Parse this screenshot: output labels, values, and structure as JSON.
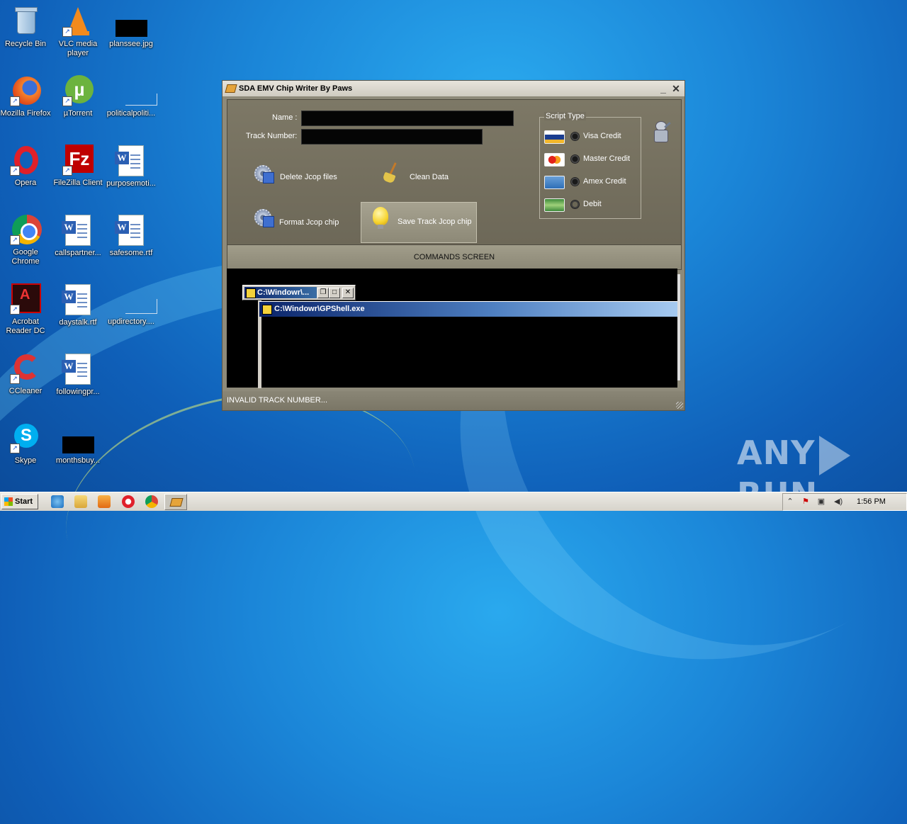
{
  "desktop": {
    "icons": [
      {
        "label": "Recycle Bin"
      },
      {
        "label": "VLC media player"
      },
      {
        "label": "planssee.jpg"
      },
      {
        "label": "Mozilla Firefox"
      },
      {
        "label": "µTorrent"
      },
      {
        "label": "politicalpoliti..."
      },
      {
        "label": "Opera"
      },
      {
        "label": "FileZilla Client"
      },
      {
        "label": "purposemoti..."
      },
      {
        "label": "Google Chrome"
      },
      {
        "label": "callspartner..."
      },
      {
        "label": "safesome.rtf"
      },
      {
        "label": "Acrobat Reader DC"
      },
      {
        "label": "daystalk.rtf"
      },
      {
        "label": "updirectory...."
      },
      {
        "label": "CCleaner"
      },
      {
        "label": "followingpr..."
      },
      {
        "label": "Skype"
      },
      {
        "label": "monthsbuy..."
      }
    ]
  },
  "app": {
    "title": "SDA EMV Chip Writer  By Paws",
    "name_label": "Name :",
    "name_value": "",
    "track_label": "Track Number:",
    "track_value": "",
    "delete_label": "Delete Jcop files",
    "clean_label": "Clean Data",
    "format_label": "Format Jcop chip",
    "save_label": "Save Track Jcop chip",
    "script_type_title": "Script Type",
    "script_types": [
      {
        "label": "Visa Credit",
        "card": "VISA",
        "selected": false
      },
      {
        "label": "Master Credit",
        "card": "MC",
        "selected": false
      },
      {
        "label": "Amex Credit",
        "card": "AMEX",
        "selected": false
      },
      {
        "label": "Debit",
        "card": "DEBIT",
        "selected": false
      }
    ],
    "commands_title": "COMMANDS SCREEN",
    "status": "INVALID TRACK NUMBER..."
  },
  "console": {
    "small_title": "C:\\Windowr\\...",
    "big_title": "C:\\Windowr\\GPShell.exe"
  },
  "taskbar": {
    "start_label": "Start",
    "clock": "1:56 PM"
  },
  "watermark": {
    "left": "ANY",
    "right": "RUN"
  },
  "colors": {
    "desktop_blue": "#1b86d8",
    "window_body": "#8e8a7a",
    "console_bg": "#000000",
    "console_caption": "#0a246a"
  }
}
